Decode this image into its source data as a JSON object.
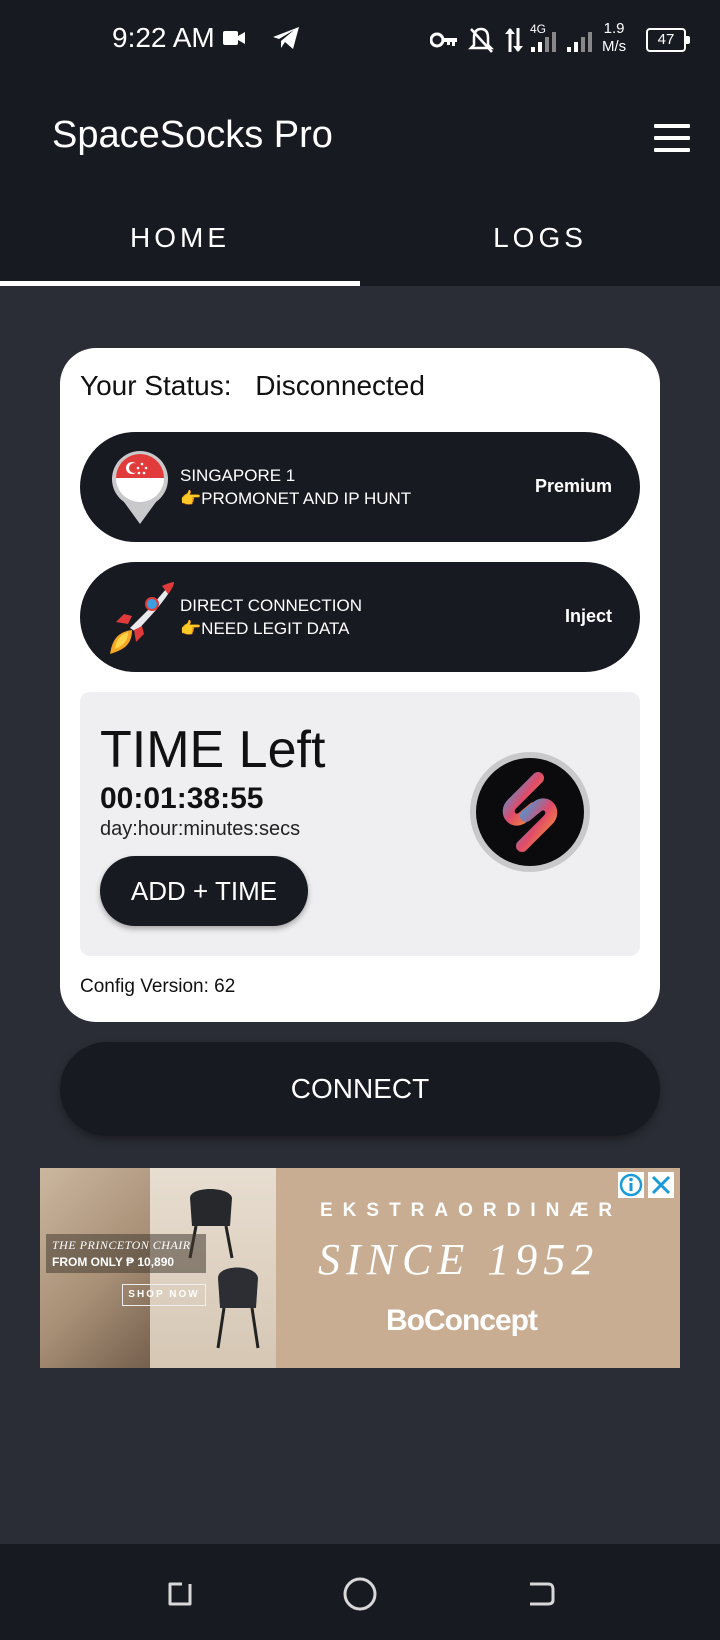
{
  "status_bar": {
    "time": "9:22 AM",
    "network_type": "4G",
    "speed_value": "1.9",
    "speed_unit": "M/s",
    "battery": "47",
    "icons": [
      "video-camera-icon",
      "telegram-icon",
      "vpn-key-icon",
      "bell-off-icon",
      "data-arrows-icon",
      "signal-4g-icon",
      "signal-icon",
      "battery-icon"
    ]
  },
  "app": {
    "title": "SpaceSocks Pro",
    "menu_icon": "hamburger-menu-icon"
  },
  "tabs": [
    {
      "label": "HOME",
      "selected": true
    },
    {
      "label": "LOGS",
      "selected": false
    }
  ],
  "status": {
    "label": "Your Status:",
    "value": "Disconnected"
  },
  "server": {
    "icon": "singapore-flag-pin-icon",
    "name": "SINGAPORE 1",
    "note": "👉PROMONET AND IP HUNT",
    "badge": "Premium"
  },
  "connection": {
    "icon": "rocket-icon",
    "name": "DIRECT CONNECTION",
    "note": "👉NEED LEGIT DATA",
    "badge": "Inject"
  },
  "timer": {
    "title": "TIME Left",
    "value": "00:01:38:55",
    "format": "day:hour:minutes:secs",
    "add_button": "ADD + TIME",
    "logo_icon": "spacesocks-logo-icon"
  },
  "config": {
    "label": "Config Version: 62"
  },
  "connect_button": "CONNECT",
  "ad": {
    "caption_title": "THE PRINCETON CHAIR",
    "caption_price": "FROM ONLY ₱ 10,890",
    "shop_button": "SHOP NOW",
    "headline": "EKSTRAORDINÆR",
    "subheadline": "SINCE 1952",
    "brand": "BoConcept",
    "info_icon": "ad-info-icon",
    "close_icon": "ad-close-icon"
  },
  "nav": {
    "recents_icon": "recents-icon",
    "home_icon": "home-circle-icon",
    "back_icon": "back-icon"
  },
  "colors": {
    "dark": "#181a22",
    "background": "#2b2d36",
    "card": "#ffffff",
    "panel": "#efeff1",
    "ad_bg": "#c9ad92"
  }
}
